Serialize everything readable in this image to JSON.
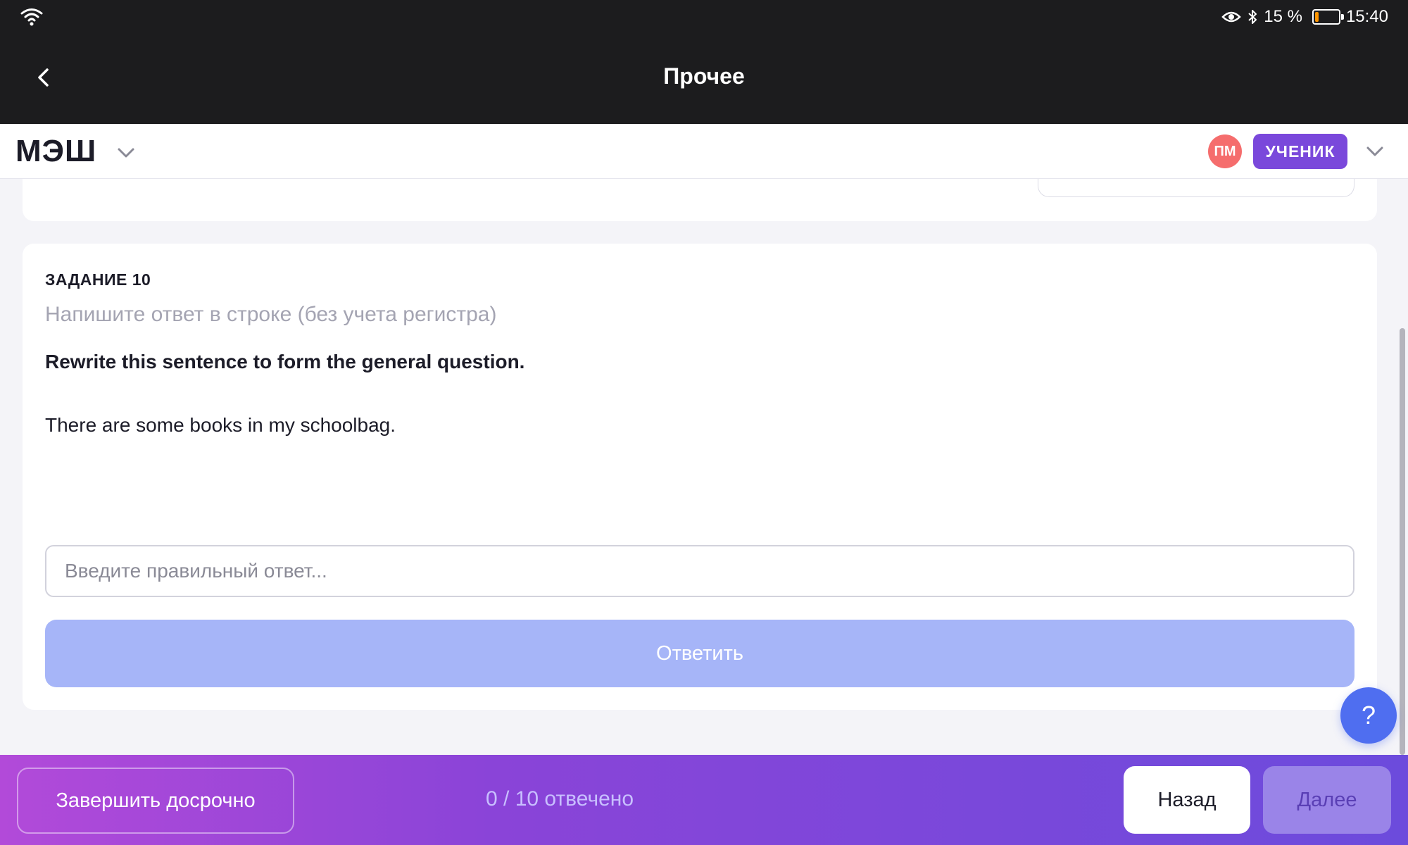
{
  "status_bar": {
    "battery_percent": "15 %",
    "battery_level": 0.15,
    "time": "15:40",
    "icons": [
      "wifi-icon",
      "eye-icon",
      "bluetooth-icon",
      "battery-icon"
    ]
  },
  "app_bar": {
    "title": "Прочее",
    "back_icon": "chevron-left-icon"
  },
  "mesh_header": {
    "logo": "МЭШ",
    "user_initials": "ПМ",
    "role": "УЧЕНИК"
  },
  "task": {
    "number_label": "ЗАДАНИЕ 10",
    "hint": "Напишите ответ в строке (без учета регистра)",
    "instruction": "Rewrite this sentence to form the general question.",
    "sentence": "There are some books in my schoolbag.",
    "answer_value": "",
    "answer_placeholder": "Введите правильный ответ...",
    "submit_label": "Ответить"
  },
  "help": {
    "label": "?"
  },
  "bottom_bar": {
    "finish_label": "Завершить досрочно",
    "progress": "0 / 10 отвечено",
    "prev_label": "Назад",
    "next_label": "Далее"
  },
  "colors": {
    "dark_bar": "#1c1c1e",
    "avatar": "#f56d6d",
    "role_badge": "#7a48db",
    "submit_disabled": "#a6b5f8",
    "help_button": "#4f6ef0",
    "gradient_start": "#b24ad9",
    "gradient_end": "#6c4bdc"
  }
}
